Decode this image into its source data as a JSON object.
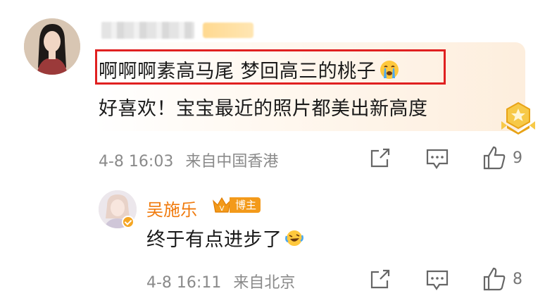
{
  "comment": {
    "text_line1": "啊啊啊素高马尾 梦回高三的桃子",
    "text_line2": "好喜欢！宝宝最近的照片都美出新高度",
    "time": "4-8 16:03",
    "source": "来自中国香港",
    "likes": "9",
    "emoji": "crying-face-emoji"
  },
  "reply": {
    "author": "吴施乐",
    "badge": "博主",
    "text": "终于有点进步了",
    "emoji": "laughing-tears-emoji",
    "time": "4-8 16:11",
    "source": "来自北京",
    "likes": "8"
  },
  "colors": {
    "highlight": "#e02020",
    "author_name": "#f07a0c",
    "badge_bg": "#f39a1a",
    "meta_text": "#8a8a8a"
  },
  "icons": [
    "share-icon",
    "comment-icon",
    "like-icon",
    "medal-icon",
    "crown-icon",
    "verified-icon"
  ]
}
